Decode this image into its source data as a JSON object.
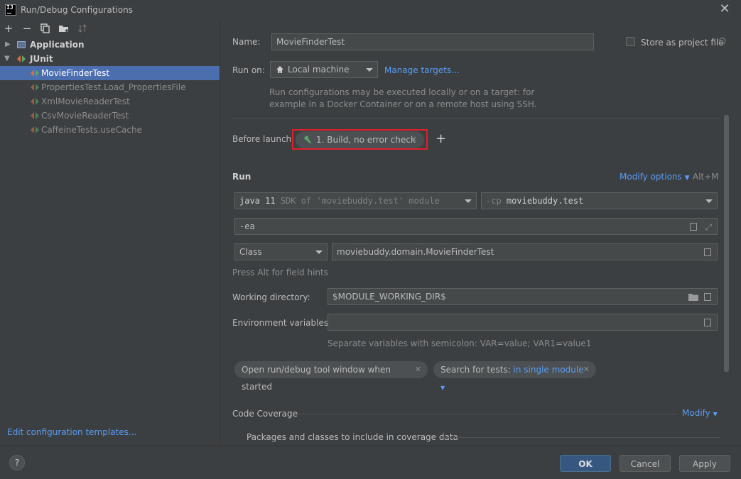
{
  "window": {
    "title": "Run/Debug Configurations",
    "app_icon_text": "IJ"
  },
  "toolbar": {
    "add": "+",
    "remove": "−",
    "copy": "⧉",
    "folder": "▬",
    "sort": "⇅"
  },
  "tree": {
    "groups": [
      {
        "label": "Application",
        "expanded": false
      },
      {
        "label": "JUnit",
        "expanded": true
      }
    ],
    "items": [
      {
        "label": "MovieFinderTest",
        "selected": true
      },
      {
        "label": "PropertiesTest.Load_PropertiesFile"
      },
      {
        "label": "XmlMovieReaderTest"
      },
      {
        "label": "CsvMovieReaderTest"
      },
      {
        "label": "CaffeineTests.useCache"
      }
    ],
    "edit_templates": "Edit configuration templates..."
  },
  "form": {
    "name_label": "Name:",
    "name_value": "MovieFinderTest",
    "store_label": "Store as project file",
    "store_checked": false,
    "run_on_label": "Run on:",
    "run_on_value": "Local machine",
    "manage_targets": "Manage targets...",
    "run_on_hint_1": "Run configurations may be executed locally or on a target: for",
    "run_on_hint_2": "example in a Docker Container or on a remote host using SSH.",
    "before_launch_label": "Before launch:",
    "before_launch_task": "1. Build, no error check",
    "before_launch_add": "+",
    "run_section": "Run",
    "modify_options": "Modify options",
    "modify_shortcut": "Alt+M",
    "jre_main": "java 11",
    "jre_detail": "SDK of 'moviebuddy.test' module",
    "cp_prefix": "-cp",
    "cp_value": "moviebuddy.test",
    "vm_options": "-ea",
    "test_kind": "Class",
    "test_class": "moviebuddy.domain.MovieFinderTest",
    "alt_hint": "Press Alt for field hints",
    "workdir_label": "Working directory:",
    "workdir_value": "$MODULE_WORKING_DIR$",
    "env_label": "Environment variables:",
    "env_value": "",
    "env_hint": "Separate variables with semicolon: VAR=value; VAR1=value1",
    "chip_open_window": "Open run/debug tool window when started",
    "chip_search_prefix": "Search for tests:",
    "chip_search_value": "in single module",
    "coverage_label": "Code Coverage",
    "coverage_modify": "Modify",
    "coverage_packages": "Packages and classes to include in coverage data"
  },
  "footer": {
    "help": "?",
    "ok": "OK",
    "cancel": "Cancel",
    "apply": "Apply"
  },
  "colors": {
    "background": "#3c3f41",
    "selection": "#4b6eaf",
    "link": "#589df6",
    "highlight_box": "#e0202a",
    "primary_button": "#365880"
  }
}
